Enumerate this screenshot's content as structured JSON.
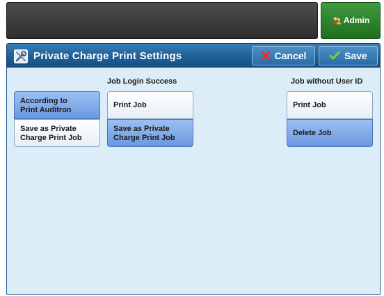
{
  "header": {
    "admin_label": "Admin"
  },
  "title_bar": {
    "title": "Private Charge Print Settings",
    "cancel_label": "Cancel",
    "save_label": "Save"
  },
  "left_group": {
    "options": [
      {
        "label": "According to\nPrint Auditron",
        "selected": true
      },
      {
        "label": "Save as Private\nCharge Print Job",
        "selected": false
      }
    ]
  },
  "job_login_success": {
    "header": "Job Login Success",
    "options": [
      {
        "label": "Print Job",
        "selected": false
      },
      {
        "label": "Save as Private\nCharge Print Job",
        "selected": true
      }
    ]
  },
  "job_without_user_id": {
    "header": "Job without User ID",
    "options": [
      {
        "label": "Print Job",
        "selected": false
      },
      {
        "label": "Delete Job",
        "selected": true
      }
    ]
  },
  "colors": {
    "title_bar": "#1d5f98",
    "panel_bg": "#dcedf7",
    "selected": "#7ea8e8",
    "admin_button": "#2e8a2e"
  },
  "icons": {
    "title": "wrench-screwdriver-icon",
    "cancel": "red-x-icon",
    "save": "green-check-icon",
    "admin": "admin-users-icon"
  }
}
